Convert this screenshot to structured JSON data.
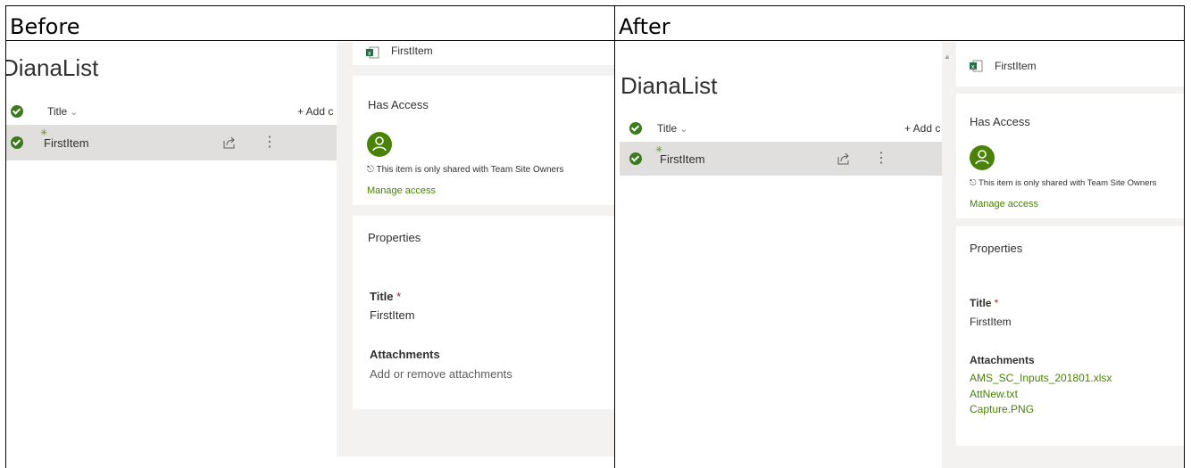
{
  "headers": {
    "before": "Before",
    "after": "After"
  },
  "before": {
    "list_title": "DianaList",
    "column_title": "Title",
    "add_column": "+ Add c",
    "row_title": "FirstItem",
    "pane": {
      "item_name": "FirstItem",
      "has_access": "Has Access",
      "shared_text": "This item is only shared with Team Site Owners",
      "manage_access": "Manage access",
      "properties": "Properties",
      "title_label": "Title",
      "required_mark": "*",
      "title_value": "FirstItem",
      "attachments_label": "Attachments",
      "attachments_placeholder": "Add or remove attachments"
    }
  },
  "after": {
    "list_title": "DianaList",
    "column_title": "Title",
    "add_column": "+ Add c",
    "row_title": "FirstItem",
    "pane": {
      "item_name": "FirstItem",
      "has_access": "Has Access",
      "shared_text": "This item is only shared with Team Site Owners",
      "manage_access": "Manage access",
      "properties": "Properties",
      "title_label": "Title",
      "required_mark": "*",
      "title_value": "FirstItem",
      "attachments_label": "Attachments",
      "attachments": [
        "AMS_SC_Inputs_201801.xlsx",
        "AttNew.txt",
        "Capture.PNG"
      ]
    }
  },
  "colors": {
    "accent_green": "#498205",
    "check_green": "#3c7a1e",
    "row_selected": "#e1dfdd",
    "pane_gray": "#f3f2f1"
  },
  "icons": [
    "checkmark-circle-icon",
    "chevron-down-icon",
    "share-icon",
    "more-icon",
    "excel-file-icon",
    "person-add-icon",
    "lock-icon",
    "new-item-sparkle-icon"
  ]
}
